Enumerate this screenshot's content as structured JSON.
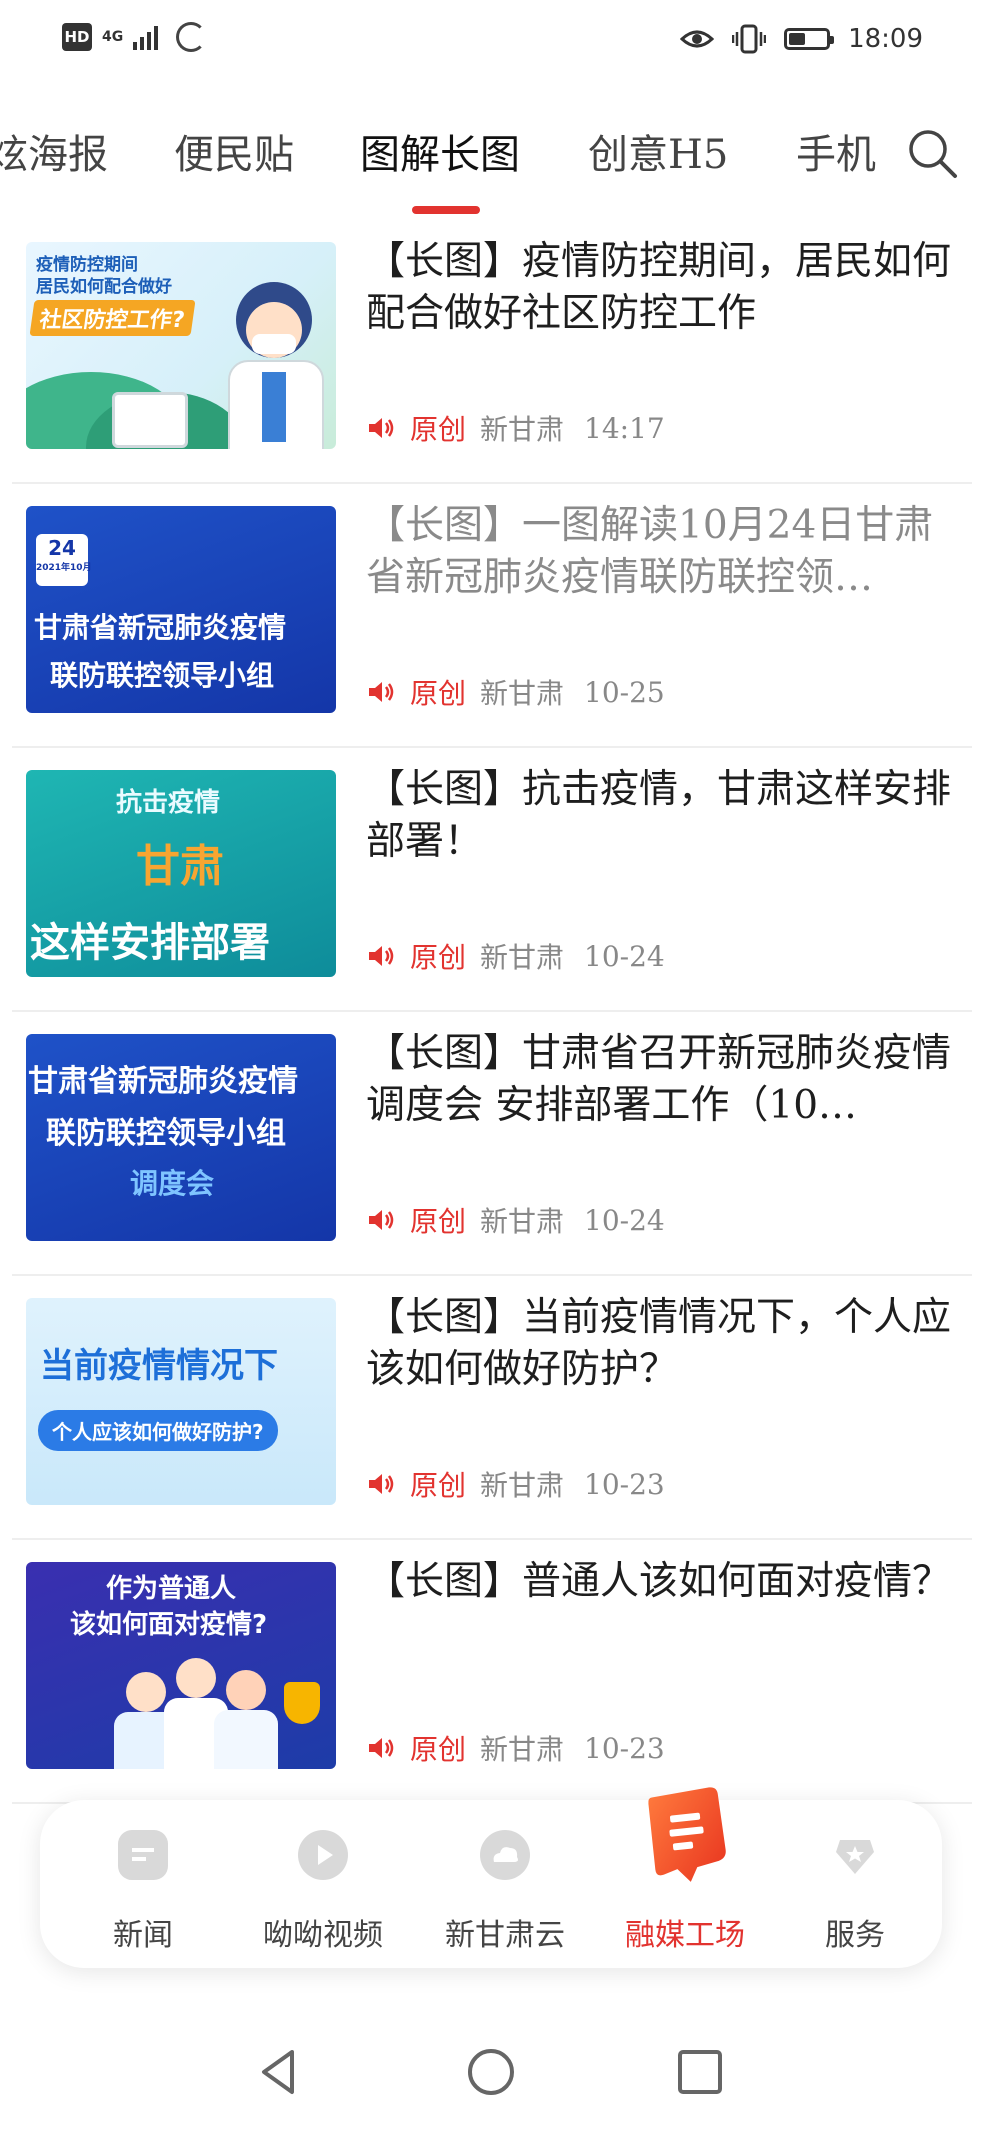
{
  "status_bar": {
    "badge": "HD",
    "network": "4G",
    "time": "18:09",
    "battery_level": 0.45
  },
  "tabs": [
    {
      "label": "炫海报",
      "active": false
    },
    {
      "label": "便民贴",
      "active": false
    },
    {
      "label": "图解长图",
      "active": true
    },
    {
      "label": "创意H5",
      "active": false
    },
    {
      "label": "手机",
      "active": false
    }
  ],
  "articles": [
    {
      "title": "【长图】疫情防控期间，居民如何配合做好社区防控工作",
      "tag": "原创",
      "source": "新甘肃",
      "time": "14:17",
      "read": false,
      "thumb": {
        "lines": [
          "疫情防控期间",
          "居民如何配合做好",
          "社区防控工作?"
        ]
      }
    },
    {
      "title": "【长图】一图解读10月24日甘肃省新冠肺炎疫情联防联控领…",
      "tag": "原创",
      "source": "新甘肃",
      "time": "10-25",
      "read": true,
      "thumb": {
        "lines": [
          "甘肃省新冠肺炎疫情",
          "联防联控领导小组"
        ],
        "date_day": "24",
        "date_label": "2021年10月"
      }
    },
    {
      "title": "【长图】抗击疫情，甘肃这样安排部署！",
      "tag": "原创",
      "source": "新甘肃",
      "time": "10-24",
      "read": false,
      "thumb": {
        "lines": [
          "抗击疫情",
          "甘肃",
          "这样安排部署"
        ]
      }
    },
    {
      "title": "【长图】甘肃省召开新冠肺炎疫情调度会 安排部署工作（10…",
      "tag": "原创",
      "source": "新甘肃",
      "time": "10-24",
      "read": false,
      "thumb": {
        "lines": [
          "甘肃省新冠肺炎疫情",
          "联防联控领导小组",
          "调度会"
        ]
      }
    },
    {
      "title": "【长图】当前疫情情况下，个人应该如何做好防护？",
      "tag": "原创",
      "source": "新甘肃",
      "time": "10-23",
      "read": false,
      "thumb": {
        "lines": [
          "当前疫情情况下",
          "个人应该如何做好防护?"
        ]
      }
    },
    {
      "title": "【长图】普通人该如何面对疫情？",
      "tag": "原创",
      "source": "新甘肃",
      "time": "10-23",
      "read": false,
      "thumb": {
        "lines": [
          "作为普通人",
          "该如何面对疫情?"
        ]
      }
    }
  ],
  "bottom_nav": [
    {
      "label": "新闻",
      "icon": "news-icon",
      "active": false
    },
    {
      "label": "呦呦视频",
      "icon": "video-play-icon",
      "active": false
    },
    {
      "label": "新甘肃云",
      "icon": "cloud-icon",
      "active": false
    },
    {
      "label": "融媒工场",
      "icon": "media-factory-icon",
      "active": true
    },
    {
      "label": "服务",
      "icon": "service-star-icon",
      "active": false
    }
  ],
  "colors": {
    "accent": "#e2332f",
    "text": "#1e1e1e",
    "muted": "#888888"
  }
}
